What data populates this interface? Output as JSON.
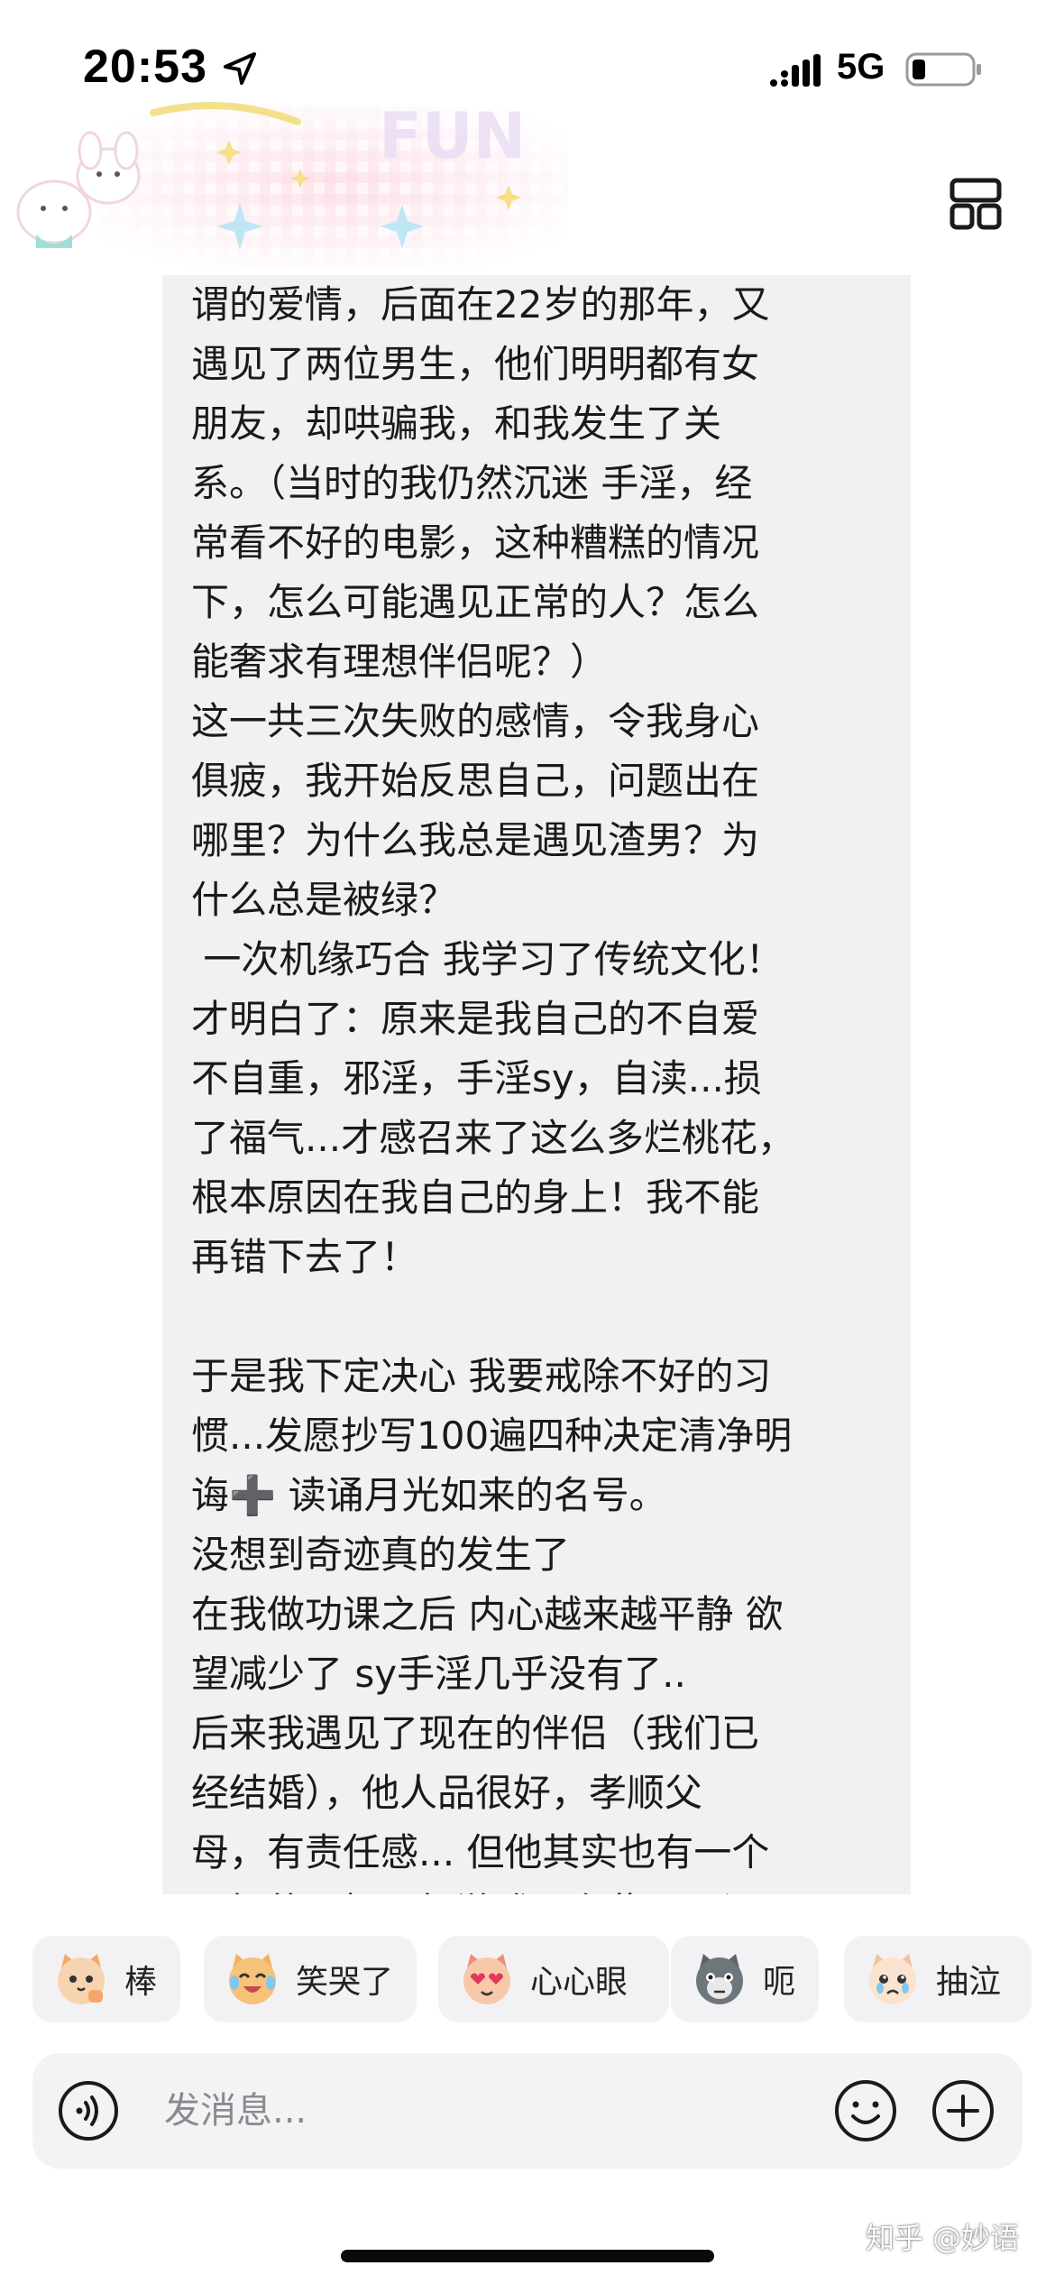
{
  "status_bar": {
    "time": "20:53",
    "network": "5G",
    "icons": [
      "location-arrow-icon",
      "signal-bars-icon",
      "battery-low-icon"
    ]
  },
  "header": {
    "decoration": "kawaii-sticker-banner",
    "decoration_text": "FUN",
    "layout_icon": "grid-layout-icon"
  },
  "message": {
    "lines": [
      "谓的爱情，后面在22岁的那年，又",
      "遇见了两位男生，他们明明都有女",
      "朋友，却哄骗我，和我发生了关",
      "系。（当时的我仍然沉迷 手淫，经",
      "常看不好的电影，这种糟糕的情况",
      "下，怎么可能遇见正常的人？怎么",
      "能奢求有理想伴侣呢？）",
      "这一共三次失败的感情，令我身心",
      "俱疲，我开始反思自己，问题出在",
      "哪里？为什么我总是遇见渣男？为",
      "什么总是被绿？",
      " 一次机缘巧合 我学习了传统文化！",
      "才明白了：原来是我自己的不自爱",
      "不自重，邪淫，手淫sy，自渎...损",
      "了福气...才感召来了这么多烂桃花，",
      "根本原因在我自己的身上！我不能",
      "再错下去了！",
      "",
      "于是我下定决心 我要戒除不好的习",
      "惯...发愿抄写100遍四种决定清净明",
      "诲➕ 读诵月光如来的名号。",
      "没想到奇迹真的发生了",
      "在我做功课之后 内心越来越平静 欲",
      "望减少了 sy手淫几乎没有了..",
      "后来我遇见了现在的伴侣（我们已",
      "经结婚），他人品很好，孝顺父",
      "母，有责任感... 但他其实也有一个",
      "不好的习惯，打游戏，有些心理问"
    ]
  },
  "reactions": [
    {
      "label": "棒",
      "emoji": "cat-thumbs-up-icon",
      "color": "#f4a66a"
    },
    {
      "label": "笑哭了",
      "emoji": "cat-laugh-cry-icon",
      "color": "#f2b15f"
    },
    {
      "label": "心心眼",
      "emoji": "cat-heart-eyes-icon",
      "color": "#f08b7b"
    },
    {
      "label": "呃",
      "emoji": "cat-awkward-icon",
      "color": "#5d6468"
    },
    {
      "label": "抽泣",
      "emoji": "cat-sob-icon",
      "color": "#f1c3a0"
    }
  ],
  "composer": {
    "placeholder": "发消息...",
    "icons": [
      "voice-icon",
      "emoji-icon",
      "plus-icon"
    ]
  },
  "watermark": "知乎 @妙语"
}
